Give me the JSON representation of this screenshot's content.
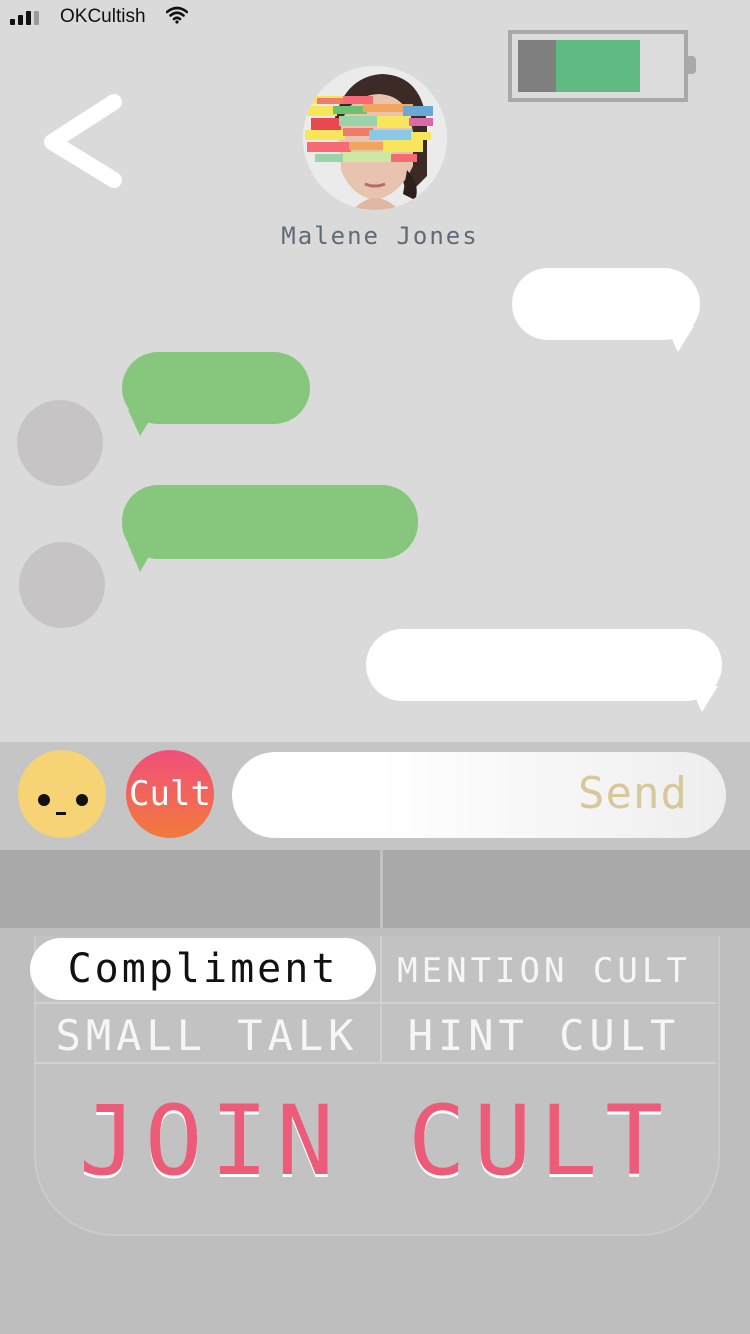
{
  "status_bar": {
    "carrier": "OKCultish",
    "signal_icon": "signal-bars-icon",
    "wifi_icon": "wifi-icon"
  },
  "battery": {
    "level": 0.76,
    "fill_color": "#5fbb82",
    "empty_color": "#7f7f7f"
  },
  "header": {
    "back_icon": "chevron-left-icon",
    "contact_name": "Malene Jones"
  },
  "messages": [
    {
      "side": "outgoing",
      "text": ""
    },
    {
      "side": "incoming",
      "text": ""
    },
    {
      "side": "incoming",
      "text": ""
    },
    {
      "side": "outgoing",
      "text": ""
    }
  ],
  "input_bar": {
    "emoji_icon": "neutral-face-icon",
    "cult_button_label": "Cult",
    "input_value": "",
    "send_label": "Send"
  },
  "options": {
    "compliment": "Compliment",
    "mention_cult": "MENTION CULT",
    "small_talk": "SMALL TALK",
    "hint_cult": "HINT CULT",
    "join_cult": "JOIN CULT",
    "selected": "compliment"
  },
  "colors": {
    "incoming_bubble": "#86c77d",
    "outgoing_bubble": "#ffffff",
    "join_text": "#ec5c79",
    "emoji_face": "#f6d375"
  }
}
